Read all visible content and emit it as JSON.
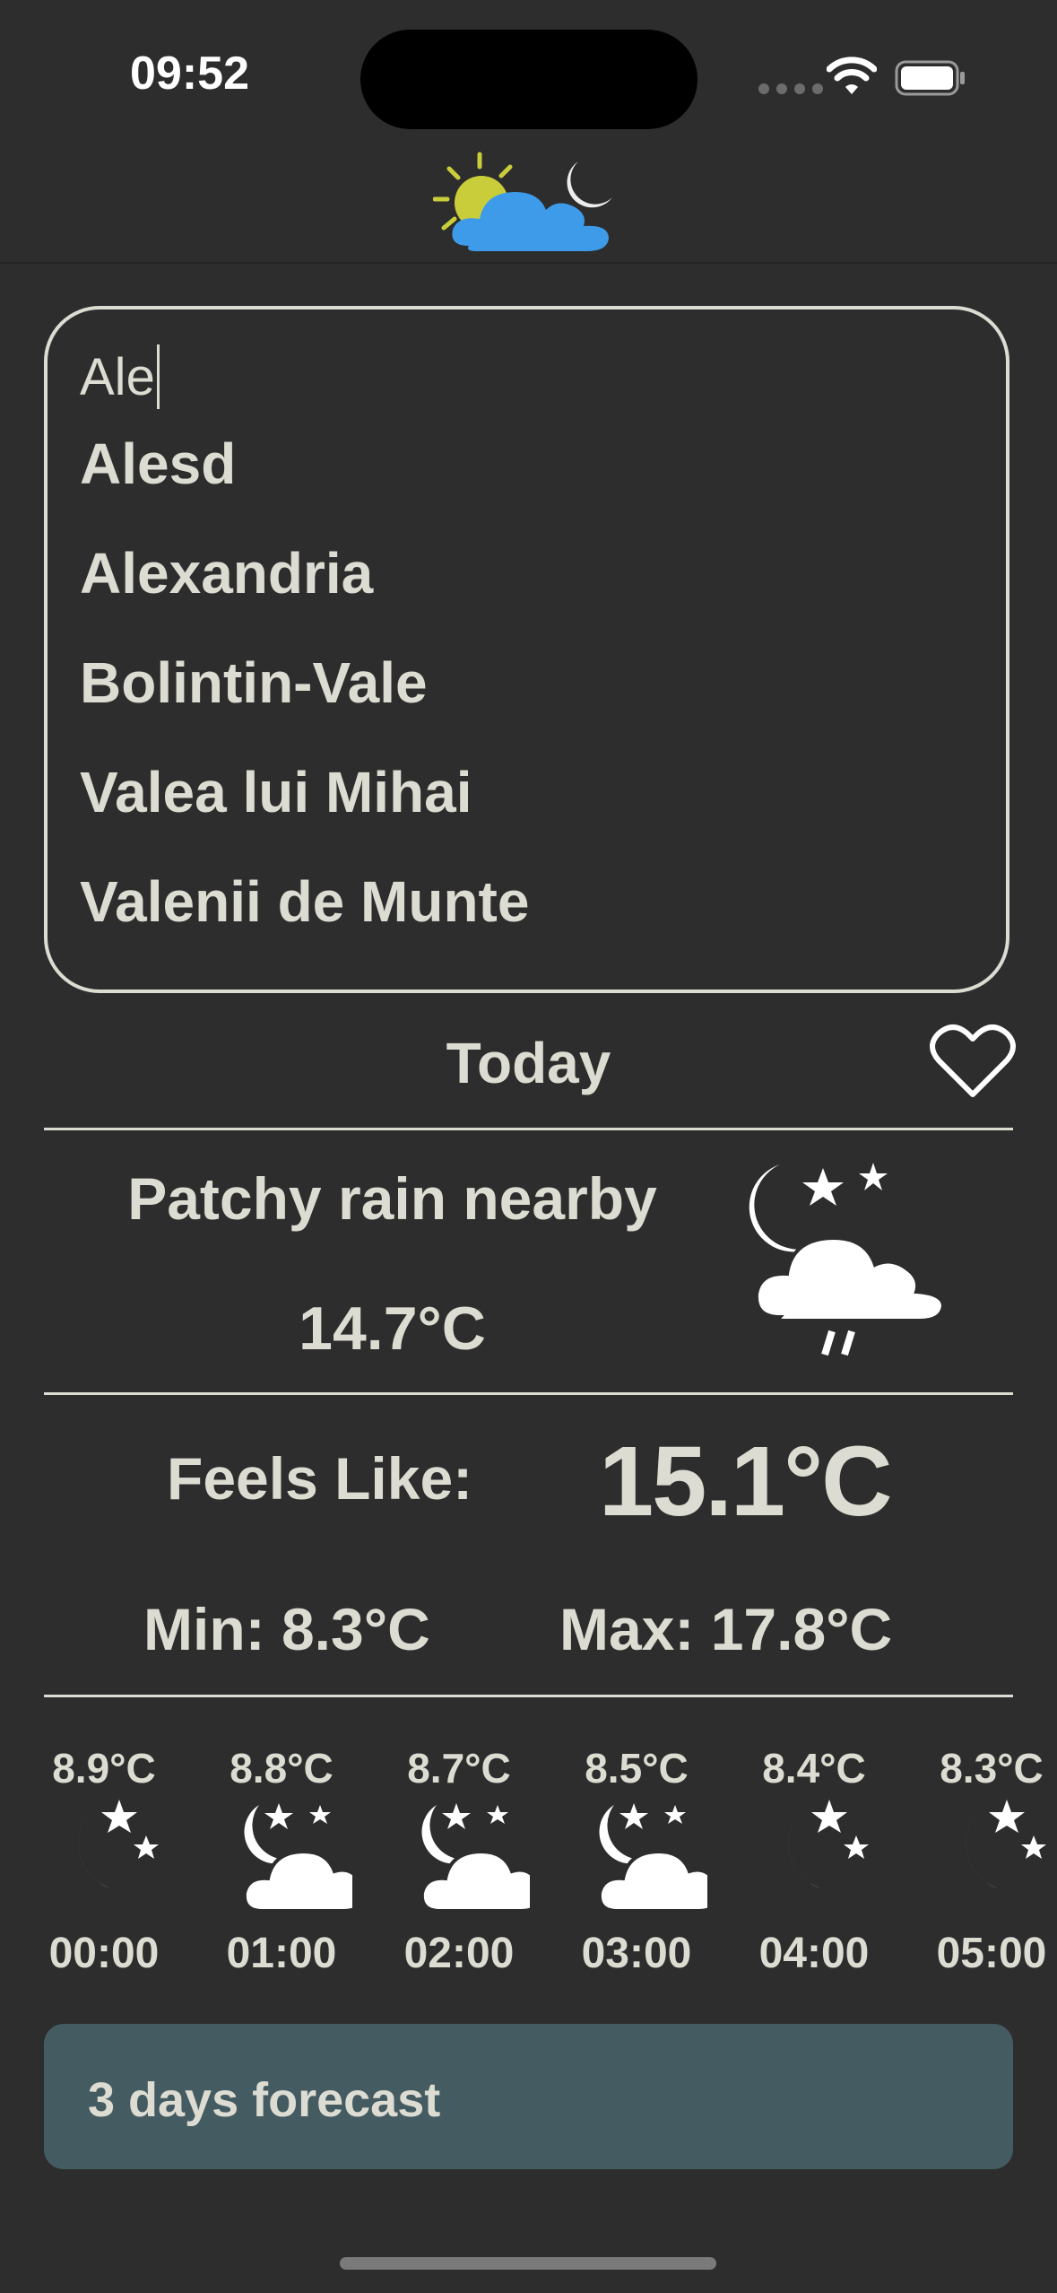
{
  "status_bar": {
    "time": "09:52"
  },
  "search": {
    "value": "Ale"
  },
  "suggestions": [
    "Alesd",
    "Alexandria",
    "Bolintin-Vale",
    "Valea lui Mihai",
    "Valenii de Munte"
  ],
  "today": {
    "title": "Today",
    "condition": "Patchy rain nearby",
    "temperature": "14.7°C",
    "feels_like_label": "Feels Like:",
    "feels_like_value": "15.1°C",
    "min": "Min: 8.3°C",
    "max": "Max: 17.8°C",
    "icon": "night-patchy-rain-icon"
  },
  "hourly": [
    {
      "temp": "8.9°C",
      "time": "00:00",
      "icon": "clear-night-icon"
    },
    {
      "temp": "8.8°C",
      "time": "01:00",
      "icon": "partly-cloudy-night-icon"
    },
    {
      "temp": "8.7°C",
      "time": "02:00",
      "icon": "partly-cloudy-night-icon"
    },
    {
      "temp": "8.5°C",
      "time": "03:00",
      "icon": "partly-cloudy-night-icon"
    },
    {
      "temp": "8.4°C",
      "time": "04:00",
      "icon": "clear-night-icon"
    },
    {
      "temp": "8.3°C",
      "time": "05:00",
      "icon": "clear-night-icon"
    }
  ],
  "forecast_button": {
    "label": "3 days forecast"
  },
  "colors": {
    "background": "#2d2d2d",
    "text": "#dcdcd2",
    "button": "#455b62",
    "cloud": "#3d9be9",
    "sun": "#c9cd3a"
  }
}
